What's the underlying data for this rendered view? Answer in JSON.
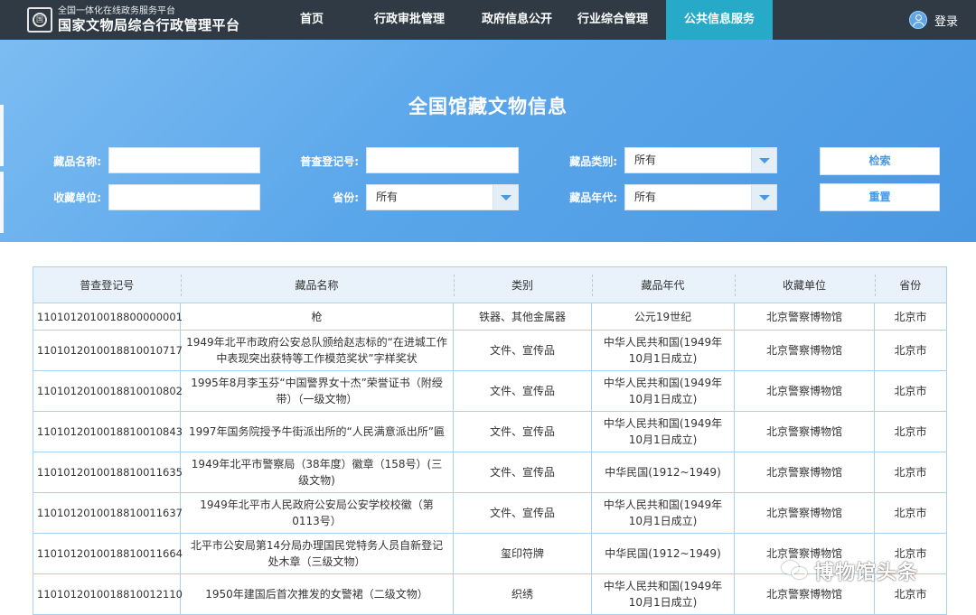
{
  "header": {
    "subtitle": "全国一体化在线政务服务平台",
    "title": "国家文物局综合行政管理平台",
    "logo_text": "国",
    "nav": [
      {
        "label": "首页"
      },
      {
        "label": "行政审批管理"
      },
      {
        "label": "政府信息公开"
      },
      {
        "label": "行业综合管理"
      },
      {
        "label": "公共信息服务",
        "active": true
      }
    ],
    "login_label": "登录"
  },
  "search": {
    "page_title": "全国馆藏文物信息",
    "name_label": "藏品名称:",
    "name_value": "",
    "reg_label": "普查登记号:",
    "reg_value": "",
    "category_label": "藏品类别:",
    "category_value": "所有",
    "unit_label": "收藏单位:",
    "unit_value": "",
    "province_label": "省份:",
    "province_value": "所有",
    "era_label": "藏品年代:",
    "era_value": "所有",
    "search_button": "检索",
    "reset_button": "重置"
  },
  "table": {
    "headers": [
      "普查登记号",
      "藏品名称",
      "类别",
      "藏品年代",
      "收藏单位",
      "省份"
    ],
    "rows": [
      [
        "1101012010018800000001",
        "枪",
        "铁器、其他金属器",
        "公元19世纪",
        "北京警察博物馆",
        "北京市"
      ],
      [
        "1101012010018810010717",
        "1949年北平市政府公安总队颁给赵志标的“在进城工作中表现突出获特等工作模范奖状”字样奖状",
        "文件、宣传品",
        "中华人民共和国(1949年10月1日成立)",
        "北京警察博物馆",
        "北京市"
      ],
      [
        "1101012010018810010802",
        "1995年8月李玉芬“中国警界女十杰”荣誉证书（附绶带）（一级文物）",
        "文件、宣传品",
        "中华人民共和国(1949年10月1日成立)",
        "北京警察博物馆",
        "北京市"
      ],
      [
        "1101012010018810010843",
        "1997年国务院授予牛街派出所的“人民满意派出所”匾",
        "文件、宣传品",
        "中华人民共和国(1949年10月1日成立)",
        "北京警察博物馆",
        "北京市"
      ],
      [
        "1101012010018810011635",
        "1949年北平市警察局（38年度）徽章（158号）(三级文物)",
        "文件、宣传品",
        "中华民国(1912~1949)",
        "北京警察博物馆",
        "北京市"
      ],
      [
        "1101012010018810011637",
        "1949年北平市人民政府公安局公安学校校徽（第0113号）",
        "文件、宣传品",
        "中华人民共和国(1949年10月1日成立)",
        "北京警察博物馆",
        "北京市"
      ],
      [
        "1101012010018810011664",
        "北平市公安局第14分局办理国民党特务人员自新登记处木章（三级文物）",
        "玺印符牌",
        "中华民国(1912~1949)",
        "北京警察博物馆",
        "北京市"
      ],
      [
        "1101012010018810012110",
        "1950年建国后首次推发的女警裙（二级文物）",
        "织绣",
        "中华人民共和国(1949年10月1日成立)",
        "北京警察博物馆",
        "北京市"
      ]
    ]
  },
  "watermark": {
    "text": "博物馆头条",
    "icon": "wechat-icon"
  },
  "colors": {
    "topbar": "#2f3a44",
    "nav_active": "#27a9c8",
    "banner": "#5aa6ea",
    "table_border": "#a9d1ef",
    "table_header_bg": "#e9f2fb"
  }
}
